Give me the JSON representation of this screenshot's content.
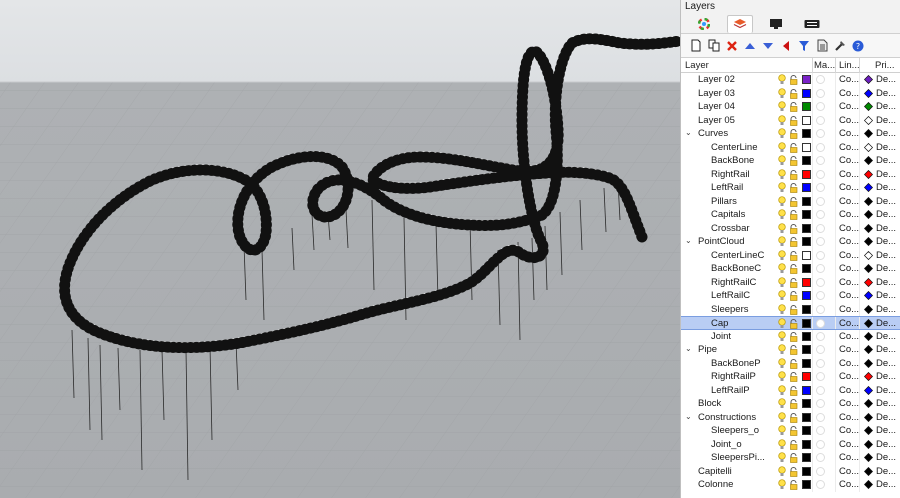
{
  "panel": {
    "title": "Layers",
    "tabs": [
      {
        "name": "color-wheel-icon",
        "active": false
      },
      {
        "name": "layers-icon",
        "active": true
      },
      {
        "name": "display-icon",
        "active": false
      },
      {
        "name": "render-icon",
        "active": false
      }
    ],
    "toolbar": [
      "new-layer-icon",
      "new-sublayer-icon",
      "delete-icon",
      "move-up-icon",
      "move-down-icon",
      "move-to-parent-icon",
      "filter-icon",
      "properties-icon",
      "tools-icon",
      "help-icon"
    ]
  },
  "columns": {
    "layer": "Layer",
    "material": "Ma...",
    "linetype": "Lin...",
    "print": "Pri..."
  },
  "layers": [
    {
      "name": "Layer 02",
      "level": 0,
      "color": "#7a22c8",
      "linetype": "Co...",
      "print_color": "#6d1fc0",
      "print": "De..."
    },
    {
      "name": "Layer 03",
      "level": 0,
      "color": "#0000ff",
      "linetype": "Co...",
      "print_color": "#0000ff",
      "print": "De..."
    },
    {
      "name": "Layer 04",
      "level": 0,
      "color": "#008a00",
      "linetype": "Co...",
      "print_color": "#008a00",
      "print": "De..."
    },
    {
      "name": "Layer 05",
      "level": 0,
      "color": "#ffffff",
      "linetype": "Co...",
      "print_color": "#ffffff",
      "print": "De..."
    },
    {
      "name": "Curves",
      "level": 0,
      "expandable": true,
      "color": "#000000",
      "linetype": "Co...",
      "print_color": "#000000",
      "print": "De..."
    },
    {
      "name": "CenterLine",
      "level": 1,
      "color": "#ffffff",
      "linetype": "Co...",
      "print_color": "#ffffff",
      "print": "De..."
    },
    {
      "name": "BackBone",
      "level": 1,
      "color": "#000000",
      "linetype": "Co...",
      "print_color": "#000000",
      "print": "De..."
    },
    {
      "name": "RightRail",
      "level": 1,
      "color": "#ff0000",
      "linetype": "Co...",
      "print_color": "#ff0000",
      "print": "De..."
    },
    {
      "name": "LeftRail",
      "level": 1,
      "color": "#0000ff",
      "linetype": "Co...",
      "print_color": "#0000ff",
      "print": "De..."
    },
    {
      "name": "Pillars",
      "level": 1,
      "color": "#000000",
      "linetype": "Co...",
      "print_color": "#000000",
      "print": "De..."
    },
    {
      "name": "Capitals",
      "level": 1,
      "color": "#000000",
      "linetype": "Co...",
      "print_color": "#000000",
      "print": "De..."
    },
    {
      "name": "Crossbar",
      "level": 1,
      "color": "#000000",
      "linetype": "Co...",
      "print_color": "#000000",
      "print": "De..."
    },
    {
      "name": "PointCloud",
      "level": 0,
      "expandable": true,
      "color": "#000000",
      "linetype": "Co...",
      "print_color": "#000000",
      "print": "De..."
    },
    {
      "name": "CenterLineC",
      "level": 1,
      "color": "#ffffff",
      "linetype": "Co...",
      "print_color": "#ffffff",
      "print": "De..."
    },
    {
      "name": "BackBoneC",
      "level": 1,
      "color": "#000000",
      "linetype": "Co...",
      "print_color": "#000000",
      "print": "De..."
    },
    {
      "name": "RightRailC",
      "level": 1,
      "color": "#ff0000",
      "linetype": "Co...",
      "print_color": "#ff0000",
      "print": "De..."
    },
    {
      "name": "LeftRailC",
      "level": 1,
      "color": "#0000ff",
      "linetype": "Co...",
      "print_color": "#0000ff",
      "print": "De..."
    },
    {
      "name": "Sleepers",
      "level": 1,
      "color": "#000000",
      "linetype": "Co...",
      "print_color": "#000000",
      "print": "De..."
    },
    {
      "name": "Cap",
      "level": 1,
      "selected": true,
      "color": "#000000",
      "linetype": "Co...",
      "print_color": "#000000",
      "print": "De..."
    },
    {
      "name": "Joint",
      "level": 1,
      "color": "#000000",
      "linetype": "Co...",
      "print_color": "#000000",
      "print": "De..."
    },
    {
      "name": "Pipe",
      "level": 0,
      "expandable": true,
      "color": "#000000",
      "linetype": "Co...",
      "print_color": "#000000",
      "print": "De..."
    },
    {
      "name": "BackBoneP",
      "level": 1,
      "color": "#000000",
      "linetype": "Co...",
      "print_color": "#000000",
      "print": "De..."
    },
    {
      "name": "RightRailP",
      "level": 1,
      "color": "#ff0000",
      "linetype": "Co...",
      "print_color": "#ff0000",
      "print": "De..."
    },
    {
      "name": "LeftRailP",
      "level": 1,
      "color": "#0000ff",
      "linetype": "Co...",
      "print_color": "#0000ff",
      "print": "De..."
    },
    {
      "name": "Block",
      "level": 0,
      "color": "#000000",
      "linetype": "Co...",
      "print_color": "#000000",
      "print": "De..."
    },
    {
      "name": "Constructions",
      "level": 0,
      "expandable": true,
      "color": "#000000",
      "linetype": "Co...",
      "print_color": "#000000",
      "print": "De..."
    },
    {
      "name": "Sleepers_o",
      "level": 1,
      "color": "#000000",
      "linetype": "Co...",
      "print_color": "#000000",
      "print": "De..."
    },
    {
      "name": "Joint_o",
      "level": 1,
      "color": "#000000",
      "linetype": "Co...",
      "print_color": "#000000",
      "print": "De..."
    },
    {
      "name": "SleepersPi...",
      "level": 1,
      "color": "#000000",
      "linetype": "Co...",
      "print_color": "#000000",
      "print": "De..."
    },
    {
      "name": "Capitelli",
      "level": 0,
      "color": "#000000",
      "linetype": "Co...",
      "print_color": "#000000",
      "print": "De..."
    },
    {
      "name": "Colonne",
      "level": 0,
      "color": "#000000",
      "linetype": "Co...",
      "print_color": "#000000",
      "print": "De..."
    }
  ],
  "colors": {
    "rail_right": "#e0141a",
    "rail_left": "#1f2fd0",
    "backbone": "#111111",
    "sleeper": "#ffffff",
    "selection": "#b9cdf4"
  }
}
